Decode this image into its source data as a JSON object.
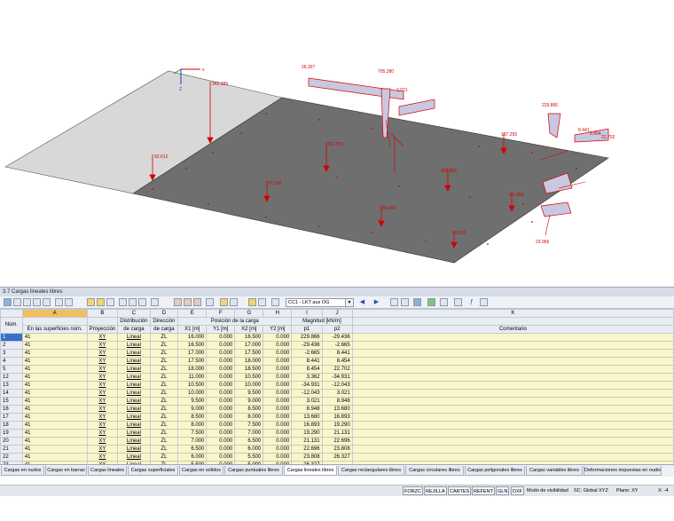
{
  "viewport": {
    "axes": {
      "x": "x",
      "z": "Z"
    },
    "labels": [
      "342.329",
      "92.612",
      "322.572",
      "97.100",
      "60.006",
      "137.293",
      "908.866",
      "10.626",
      "65.866",
      "229.866",
      "8.441",
      "8.454",
      "22.702",
      "23.966",
      "26.327",
      "705.280",
      "3.021"
    ]
  },
  "panel": {
    "title": "3.7 Cargas lineales libres"
  },
  "toolbar": {
    "loadcase": "CC1 - LKT aus OG"
  },
  "table": {
    "col_letters": [
      "A",
      "B",
      "C",
      "D",
      "E",
      "F",
      "G",
      "H",
      "I",
      "J",
      "K"
    ],
    "head1": {
      "num": "Núm.",
      "distribution": "Distribución",
      "direction": "Dirección",
      "position": "Posición de la carga",
      "magnitude": "Magnitud [kN/m]"
    },
    "head2": {
      "surfaces": "En las superficies núm.",
      "projection": "Proyección",
      "distribution": "de carga",
      "direction": "de carga",
      "x1": "X1 [m]",
      "y1": "Y1 [m]",
      "x2": "X2 [m]",
      "y2": "Y2 [m]",
      "p1": "p1",
      "p2": "p2",
      "comment": "Comentario"
    },
    "rows": [
      {
        "n": "1",
        "a": "41",
        "b": "XY",
        "c": "Lineal",
        "d": "ZL",
        "e": "16.000",
        "f": "0.000",
        "g": "16.500",
        "h": "0.000",
        "i": "229.866",
        "j": "-29.436"
      },
      {
        "n": "2",
        "a": "41",
        "b": "XY",
        "c": "Lineal",
        "d": "ZL",
        "e": "16.500",
        "f": "0.000",
        "g": "17.000",
        "h": "0.000",
        "i": "-29.436",
        "j": "-2.665"
      },
      {
        "n": "3",
        "a": "41",
        "b": "XY",
        "c": "Lineal",
        "d": "ZL",
        "e": "17.000",
        "f": "0.000",
        "g": "17.500",
        "h": "0.000",
        "i": "-2.665",
        "j": "8.441"
      },
      {
        "n": "4",
        "a": "41",
        "b": "XY",
        "c": "Lineal",
        "d": "ZL",
        "e": "17.500",
        "f": "0.000",
        "g": "18.000",
        "h": "0.000",
        "i": "8.441",
        "j": "8.454"
      },
      {
        "n": "5",
        "a": "41",
        "b": "XY",
        "c": "Lineal",
        "d": "ZL",
        "e": "18.000",
        "f": "0.000",
        "g": "18.500",
        "h": "0.000",
        "i": "8.454",
        "j": "22.702"
      },
      {
        "n": "12",
        "a": "41",
        "b": "XY",
        "c": "Lineal",
        "d": "ZL",
        "e": "11.000",
        "f": "0.000",
        "g": "10.500",
        "h": "0.000",
        "i": "3.362",
        "j": "-34.931"
      },
      {
        "n": "13",
        "a": "41",
        "b": "XY",
        "c": "Lineal",
        "d": "ZL",
        "e": "10.500",
        "f": "0.000",
        "g": "10.000",
        "h": "0.000",
        "i": "-34.931",
        "j": "-12.043"
      },
      {
        "n": "14",
        "a": "41",
        "b": "XY",
        "c": "Lineal",
        "d": "ZL",
        "e": "10.000",
        "f": "0.000",
        "g": "9.500",
        "h": "0.000",
        "i": "-12.043",
        "j": "3.021"
      },
      {
        "n": "15",
        "a": "41",
        "b": "XY",
        "c": "Lineal",
        "d": "ZL",
        "e": "9.500",
        "f": "0.000",
        "g": "9.000",
        "h": "0.000",
        "i": "3.021",
        "j": "8.948"
      },
      {
        "n": "16",
        "a": "41",
        "b": "XY",
        "c": "Lineal",
        "d": "ZL",
        "e": "9.000",
        "f": "0.000",
        "g": "8.500",
        "h": "0.000",
        "i": "8.948",
        "j": "13.680"
      },
      {
        "n": "17",
        "a": "41",
        "b": "XY",
        "c": "Lineal",
        "d": "ZL",
        "e": "8.500",
        "f": "0.000",
        "g": "8.000",
        "h": "0.000",
        "i": "13.680",
        "j": "16.893"
      },
      {
        "n": "18",
        "a": "41",
        "b": "XY",
        "c": "Lineal",
        "d": "ZL",
        "e": "8.000",
        "f": "0.000",
        "g": "7.500",
        "h": "0.000",
        "i": "16.893",
        "j": "19.290"
      },
      {
        "n": "19",
        "a": "41",
        "b": "XY",
        "c": "Lineal",
        "d": "ZL",
        "e": "7.500",
        "f": "0.000",
        "g": "7.000",
        "h": "0.000",
        "i": "19.290",
        "j": "21.131"
      },
      {
        "n": "20",
        "a": "41",
        "b": "XY",
        "c": "Lineal",
        "d": "ZL",
        "e": "7.000",
        "f": "0.000",
        "g": "6.500",
        "h": "0.000",
        "i": "21.131",
        "j": "22.696"
      },
      {
        "n": "21",
        "a": "41",
        "b": "XY",
        "c": "Lineal",
        "d": "ZL",
        "e": "6.500",
        "f": "0.000",
        "g": "6.000",
        "h": "0.000",
        "i": "22.696",
        "j": "23.808"
      },
      {
        "n": "22",
        "a": "41",
        "b": "XY",
        "c": "Lineal",
        "d": "ZL",
        "e": "6.000",
        "f": "0.000",
        "g": "5.500",
        "h": "0.000",
        "i": "23.808",
        "j": "26.327"
      },
      {
        "n": "23",
        "a": "41",
        "b": "XY",
        "c": "Lineal",
        "d": "ZL",
        "e": "5.500",
        "f": "0.000",
        "g": "5.000",
        "h": "0.000",
        "i": "26.327",
        "j": ""
      }
    ]
  },
  "tabs": [
    "Cargas en nudos",
    "Cargas en barras",
    "Cargas lineales",
    "Cargas superficiales",
    "Cargas en sólidos",
    "Cargas puntuales libres",
    "Cargas lineales libres",
    "Cargas rectangulares libres",
    "Cargas circulares libres",
    "Cargas poligonales libres",
    "Cargas variables libres",
    "Deformaciones impuestas en nudos"
  ],
  "status": {
    "buttons": [
      "FORZC",
      "REJILLA",
      "CARTES",
      "REFENT",
      "GLN",
      "DXF"
    ],
    "visibility": "Modo de visibilidad",
    "cs": "SC: Global XYZ",
    "plane": "Plano: XY",
    "coord": "X: -4"
  }
}
